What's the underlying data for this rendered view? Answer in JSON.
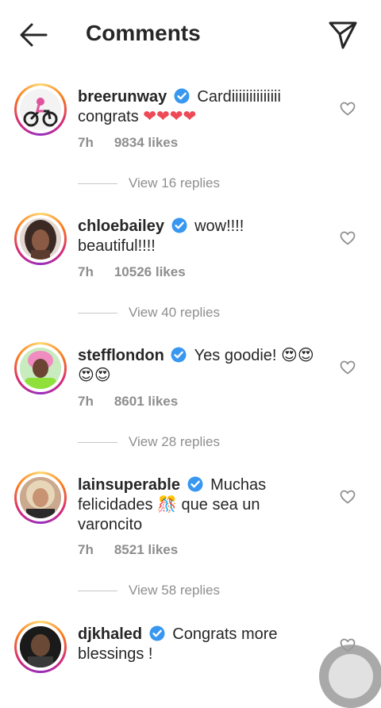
{
  "header": {
    "title": "Comments",
    "back_icon": "arrow-left-icon",
    "share_icon": "paper-plane-icon"
  },
  "comments": [
    {
      "username": "breerunway",
      "verified": true,
      "text": "Cardiiiiiiiiiiiiii congrats",
      "emoji": "❤❤❤❤",
      "time": "7h",
      "likes": "9834 likes",
      "replies": "View 16 replies"
    },
    {
      "username": "chloebailey",
      "verified": true,
      "text": "wow!!!! beautiful!!!!",
      "time": "7h",
      "likes": "10526 likes",
      "replies": "View 40 replies"
    },
    {
      "username": "stefflondon",
      "verified": true,
      "text": "Yes goodie!",
      "emoji": "😍😍😍😍",
      "time": "7h",
      "likes": "8601 likes",
      "replies": "View 28 replies"
    },
    {
      "username": "lainsuperable",
      "verified": true,
      "text_a": "Muchas felicidades",
      "emoji": "🎊",
      "text_b": "que sea un varoncito",
      "time": "7h",
      "likes": "8521 likes",
      "replies": "View 58 replies"
    },
    {
      "username": "djkhaled",
      "verified": true,
      "text": "Congrats more blessings !"
    }
  ],
  "colors": {
    "verified": "#3897f0",
    "heart_red": "#ed4956",
    "muted": "#8e8e8e"
  }
}
